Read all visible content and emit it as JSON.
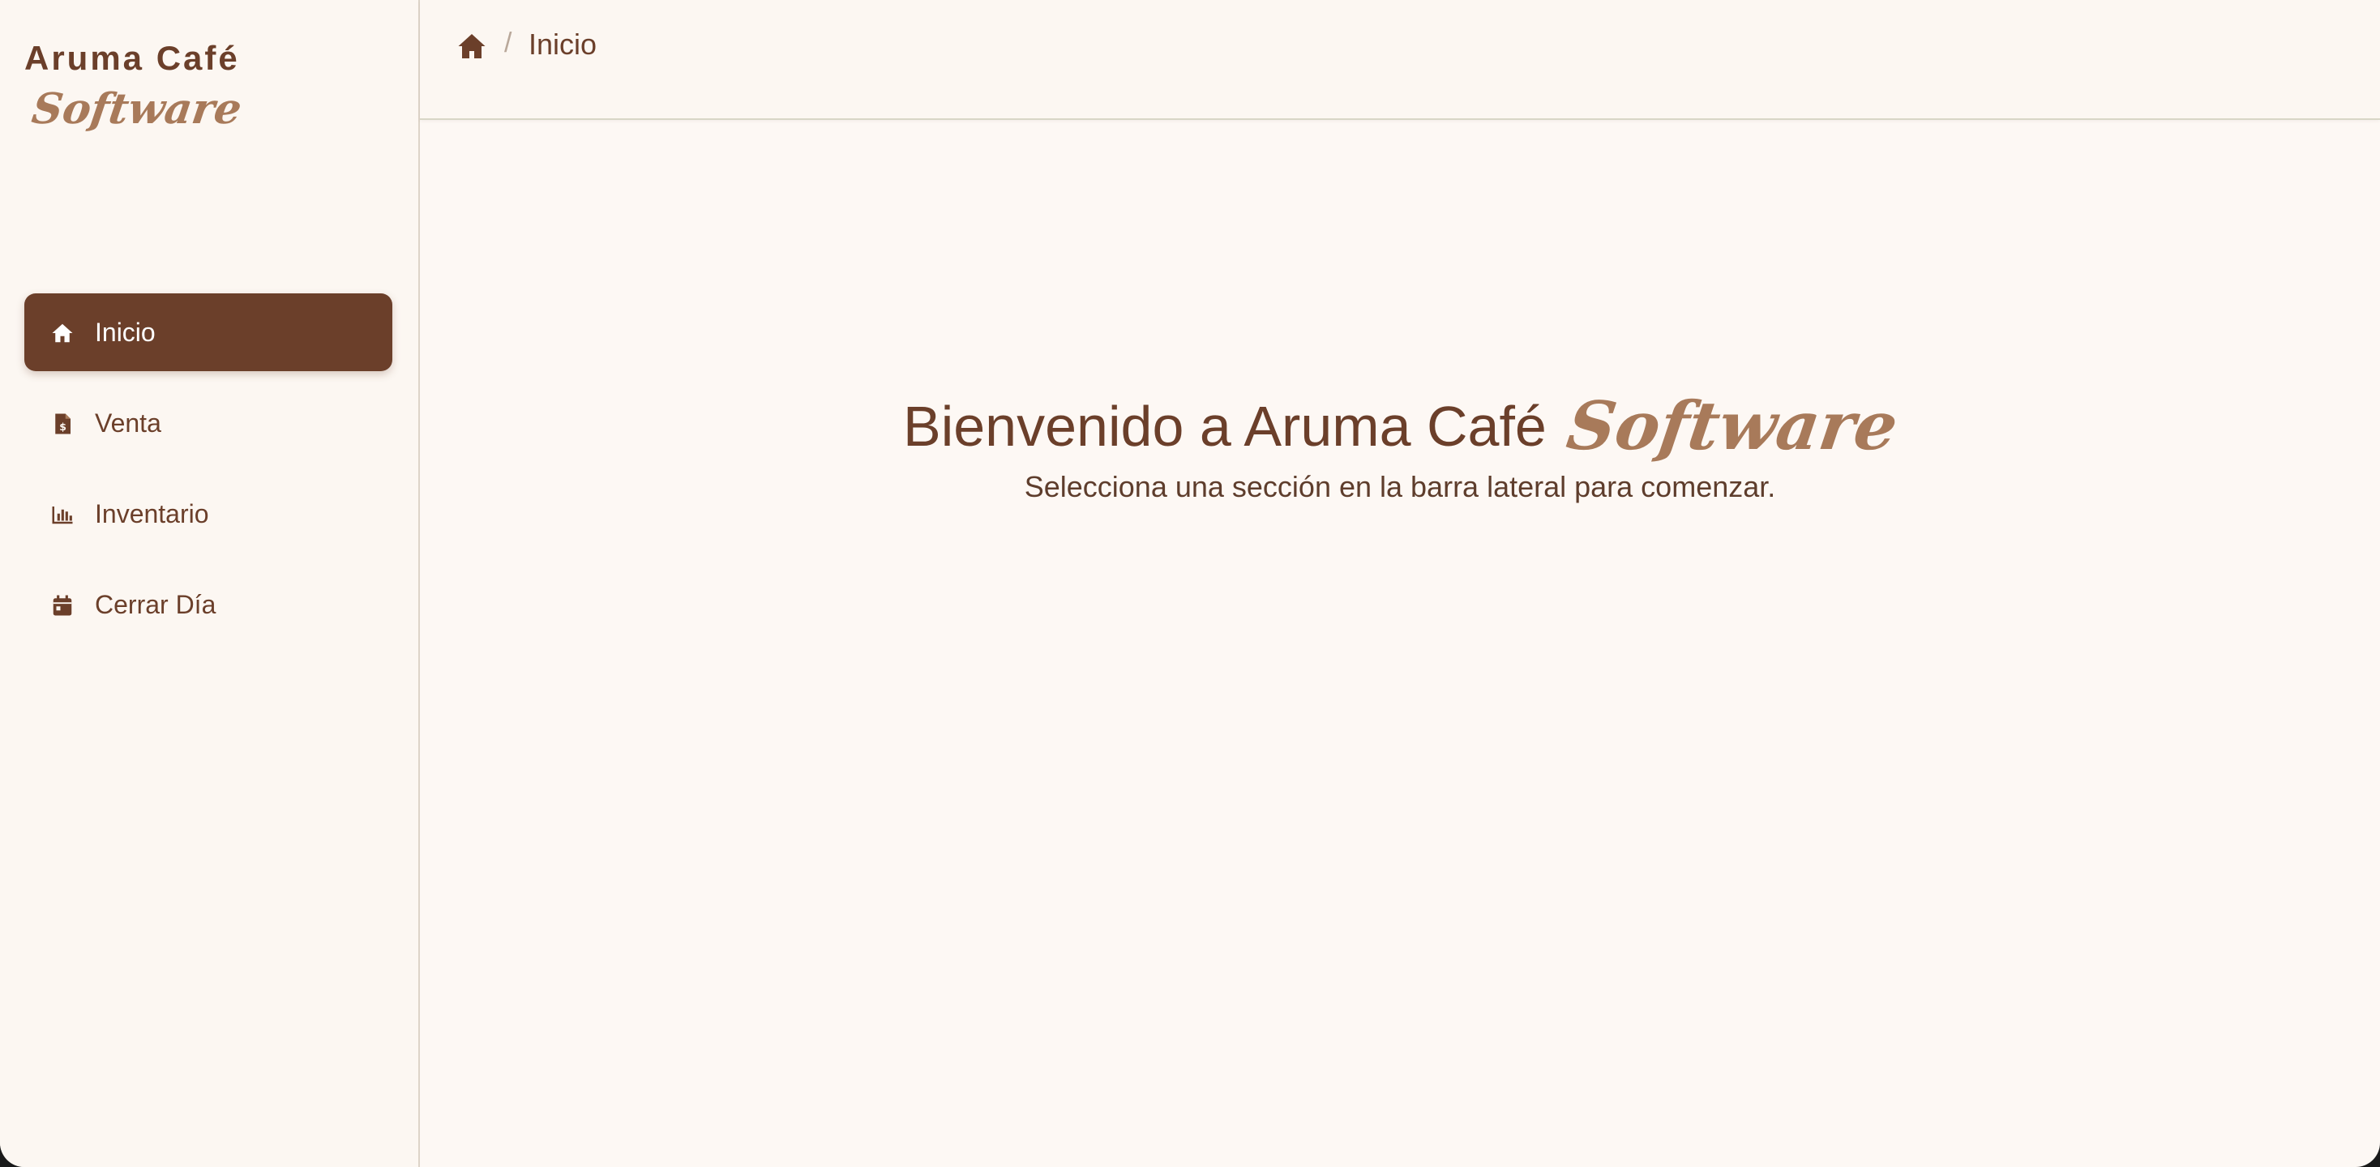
{
  "brand": {
    "title": "Aruma Café",
    "script": "Software"
  },
  "sidebar": {
    "items": [
      {
        "label": "Inicio",
        "icon": "home-icon",
        "active": true
      },
      {
        "label": "Venta",
        "icon": "receipt-icon",
        "active": false
      },
      {
        "label": "Inventario",
        "icon": "bar-chart-icon",
        "active": false
      },
      {
        "label": "Cerrar Día",
        "icon": "calendar-icon",
        "active": false
      }
    ]
  },
  "breadcrumb": {
    "separator": "/",
    "current": "Inicio"
  },
  "main": {
    "welcome_title": "Bienvenido a Aruma Café",
    "welcome_script": "Software",
    "welcome_subtitle": "Selecciona una sección en la barra lateral para comenzar."
  },
  "colors": {
    "primary": "#6b3f2a",
    "accent": "#a87a5a",
    "background": "#fdf8f4"
  }
}
